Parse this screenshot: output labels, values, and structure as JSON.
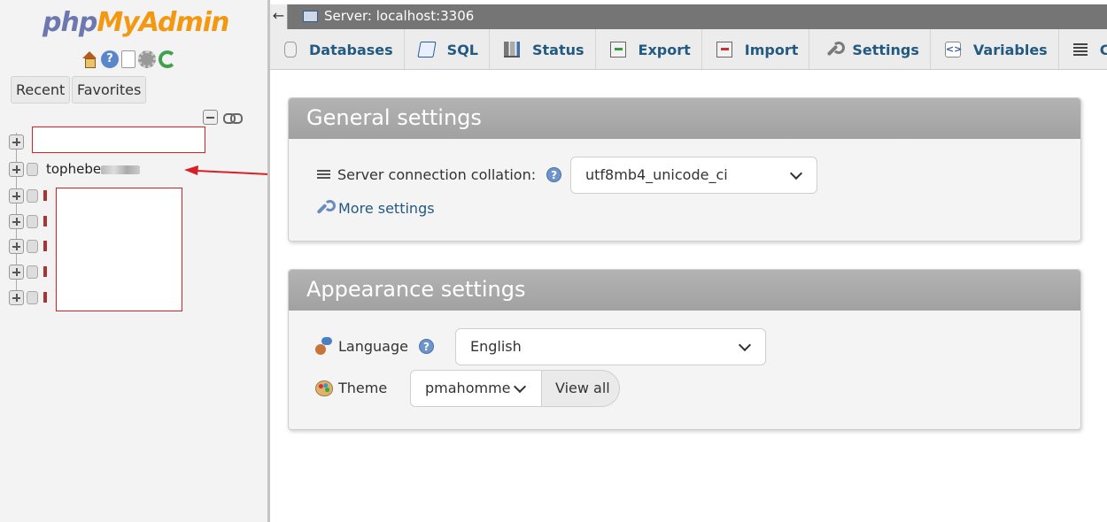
{
  "sidebar": {
    "logo_php": "php",
    "logo_rest": "MyAdmin",
    "icons": [
      "home-icon",
      "help-icon",
      "docs-icon",
      "settings-icon",
      "reload-icon"
    ],
    "buttons": {
      "recent": "Recent",
      "favorites": "Favorites"
    },
    "databases": [
      {
        "label": "tophebe"
      }
    ]
  },
  "topbar": {
    "back_glyph": "←",
    "server_label": "Server: localhost:3306"
  },
  "tabs": [
    {
      "label": "Databases",
      "icon": "database-icon"
    },
    {
      "label": "SQL",
      "icon": "sql-icon"
    },
    {
      "label": "Status",
      "icon": "status-icon"
    },
    {
      "label": "Export",
      "icon": "export-icon"
    },
    {
      "label": "Import",
      "icon": "import-icon"
    },
    {
      "label": "Settings",
      "icon": "wrench-icon"
    },
    {
      "label": "Variables",
      "icon": "variables-icon"
    },
    {
      "label": "Charsets",
      "icon": "charsets-icon"
    }
  ],
  "general": {
    "title": "General settings",
    "collation_label": "Server connection collation:",
    "collation_value": "utf8mb4_unicode_ci",
    "more_settings": "More settings"
  },
  "appearance": {
    "title": "Appearance settings",
    "language_label": "Language",
    "language_value": "English",
    "theme_label": "Theme",
    "theme_value": "pmahomme",
    "view_all": "View all"
  },
  "help_glyph": "?",
  "var_glyph": "<>",
  "colors": {
    "link": "#235a81",
    "logo_php": "#6c78af",
    "logo_admin": "#f29811",
    "annotation_red": "#d91f26",
    "panel_header": "#a8a8a8"
  }
}
